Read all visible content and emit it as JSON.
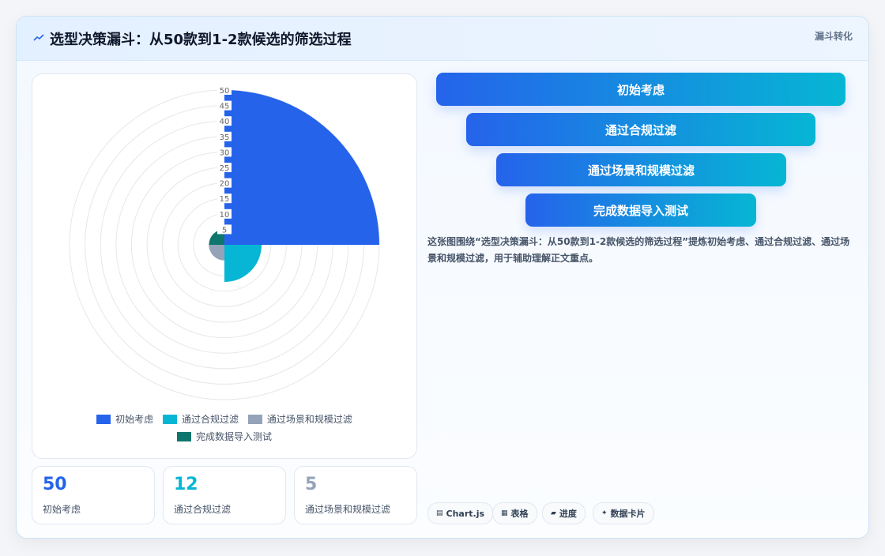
{
  "header": {
    "title": "选型决策漏斗：从50款到1-2款候选的筛选过程",
    "tag": "漏斗转化"
  },
  "chart_data": {
    "type": "polarArea",
    "categories": [
      "初始考虑",
      "通过合规过滤",
      "通过场景和规模过滤",
      "完成数据导入测试"
    ],
    "values": [
      50,
      12,
      5,
      5
    ],
    "colors": [
      "#2563eb",
      "#06b6d4",
      "#94a3b8",
      "#0f766e"
    ],
    "rlim": [
      0,
      50
    ],
    "rticks": [
      5,
      10,
      15,
      20,
      25,
      30,
      35,
      40,
      45,
      50
    ],
    "legend": "bottom"
  },
  "stats": [
    {
      "value": "50",
      "label": "初始考虑",
      "color": "#2563eb"
    },
    {
      "value": "12",
      "label": "通过合规过滤",
      "color": "#06b6d4"
    },
    {
      "value": "5",
      "label": "通过场景和规模过滤",
      "color": "#94a3b8"
    }
  ],
  "funnel": [
    "初始考虑",
    "通过合规过滤",
    "通过场景和规模过滤",
    "完成数据导入测试"
  ],
  "description": "这张图围绕“选型决策漏斗：从50款到1-2款候选的筛选过程”提炼初始考虑、通过合规过滤、通过场景和规模过滤，用于辅助理解正文重点。",
  "pills": [
    {
      "icon": "▤",
      "label": "Chart.js"
    },
    {
      "icon": "▦",
      "label": "表格"
    },
    {
      "icon": "▰",
      "label": "进度"
    },
    {
      "icon": "✦",
      "label": "数据卡片"
    }
  ]
}
